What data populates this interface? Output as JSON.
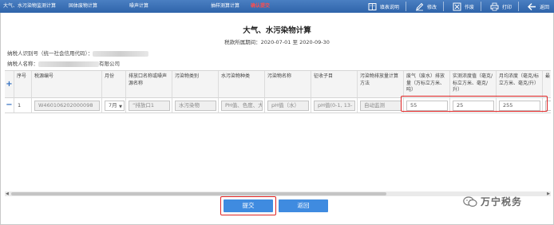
{
  "topbar": {
    "tabs": [
      {
        "label": "大气、水污染物监测计算"
      },
      {
        "label": "固体废物计算"
      },
      {
        "label": "噪声计算"
      },
      {
        "label": "抽样测算计算"
      },
      {
        "label": "确认提交",
        "active": true
      }
    ],
    "tools": [
      {
        "label": "填表说明",
        "icon": "book-icon"
      },
      {
        "label": "修改",
        "icon": "pencil-icon"
      },
      {
        "label": "作废",
        "icon": "void-icon"
      },
      {
        "label": "打印",
        "icon": "printer-icon"
      },
      {
        "label": "返回",
        "icon": "back-arrow-icon"
      }
    ]
  },
  "page": {
    "title": "大气、水污染物计算",
    "period": "税款所属期间：2020-07-01 至 2020-09-30",
    "taxpayer_id_label": "纳税人识别号（统一社会信用代码）：",
    "taxpayer_name_label": "纳税人名称：",
    "taxpayer_name_suffix": "有限公司"
  },
  "table": {
    "headers": [
      "序号",
      "税源编号",
      "月份",
      "排放口名称或噪声源名称",
      "污染物类别",
      "水污染物种类",
      "污染物名称",
      "征收子目",
      "污染物排放量计算方法",
      "废气（废水）排放量（万标立方米、吨）",
      "实测浓度值（毫克/标立方米、毫克/升）",
      "月均浓度（毫克/标立方米、毫克/升）",
      "最"
    ],
    "rows": [
      {
        "index": "1",
        "source_no": "W460106202000098",
        "month": "7月",
        "outlet": "“排放口1",
        "category": "水污染物",
        "water_type": "PH值、色度、大",
        "pollutant": "pH值（水）",
        "sub_item": "pH值(0-1, 13-",
        "method": "自动监测",
        "emission": "55",
        "measured": "25",
        "monthly_avg": "255"
      }
    ]
  },
  "buttons": {
    "submit": "提交",
    "back": "返回"
  },
  "watermark": {
    "text": "万宁税务"
  },
  "colors": {
    "topbar": "#2f64aa",
    "highlight": "#e02424",
    "button": "#3f8be0"
  }
}
